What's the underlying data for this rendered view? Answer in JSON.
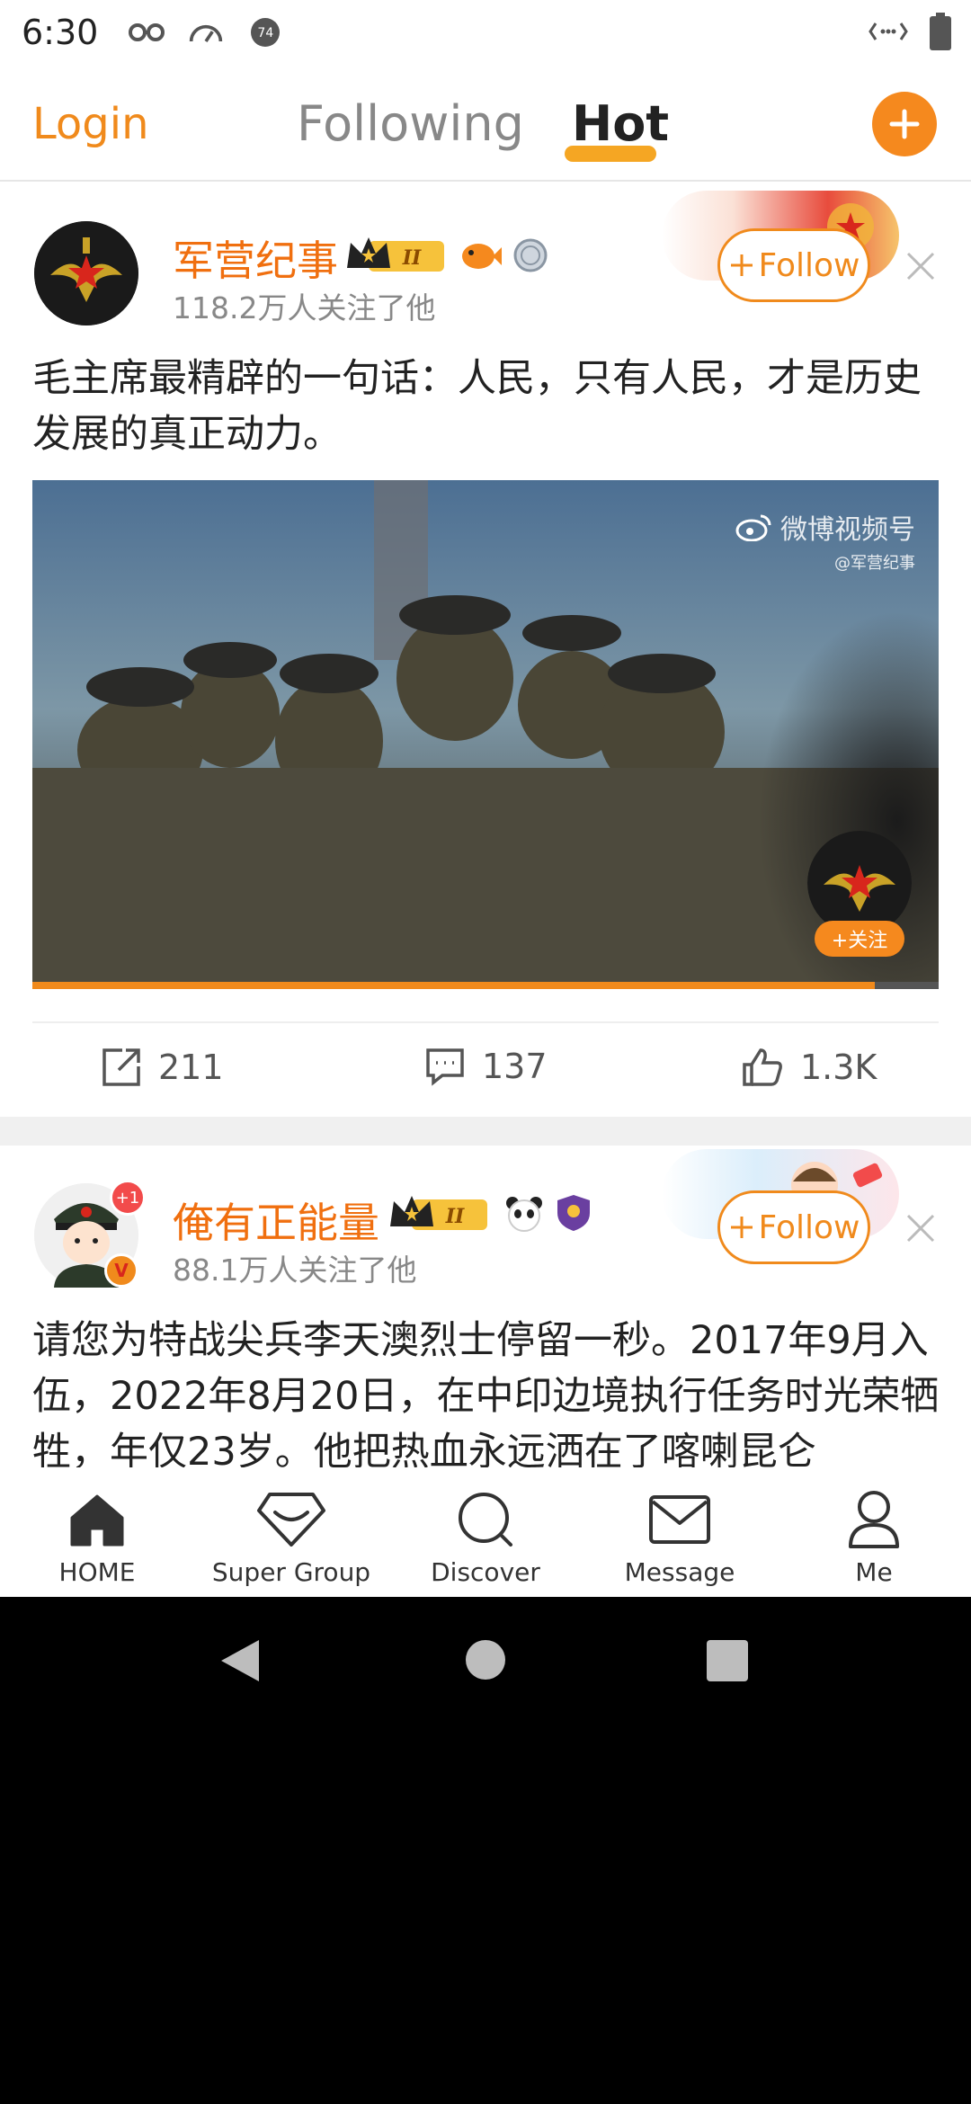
{
  "status_bar": {
    "time": "6:30",
    "notification_badge": "74",
    "icons": [
      "glasses-icon",
      "speedometer-icon",
      "notification-badge-icon",
      "data-arrows-icon",
      "battery-icon"
    ]
  },
  "top_nav": {
    "login": "Login",
    "tabs": [
      {
        "label": "Following",
        "active": false
      },
      {
        "label": "Hot",
        "active": true
      }
    ],
    "add_icon": "plus-icon"
  },
  "feed": [
    {
      "username": "军营纪事",
      "followers": "118.2万人关注了他",
      "level_badge": "II",
      "follow_label": "Follow",
      "text": "毛主席最精辟的一句话：人民，只有人民，才是历史发展的真正动力。",
      "video": {
        "watermark_title": "微博视频号",
        "watermark_sub": "@军营纪事",
        "follow_overlay": "+关注",
        "progress": 0.93
      },
      "actions": {
        "reposts": "211",
        "comments": "137",
        "likes": "1.3K"
      }
    },
    {
      "username": "俺有正能量",
      "followers": "88.1万人关注了他",
      "level_badge": "II",
      "avatar_badge": "+1",
      "verified_mark": "V",
      "follow_label": "Follow",
      "text": "请您为特战尖兵李天澳烈士停留一秒。2017年9月入伍，2022年8月20日，在中印边境执行任务时光荣牺牲，年仅23岁。他把热血永远洒在了喀喇昆仑"
    }
  ],
  "bottom_nav": [
    {
      "label": "HOME",
      "icon": "home-icon"
    },
    {
      "label": "Super Group",
      "icon": "diamond-icon"
    },
    {
      "label": "Discover",
      "icon": "search-icon"
    },
    {
      "label": "Message",
      "icon": "mail-icon"
    },
    {
      "label": "Me",
      "icon": "person-icon"
    }
  ],
  "colors": {
    "accent": "#f08a1c",
    "username": "#f06f0f",
    "muted": "#888888"
  }
}
